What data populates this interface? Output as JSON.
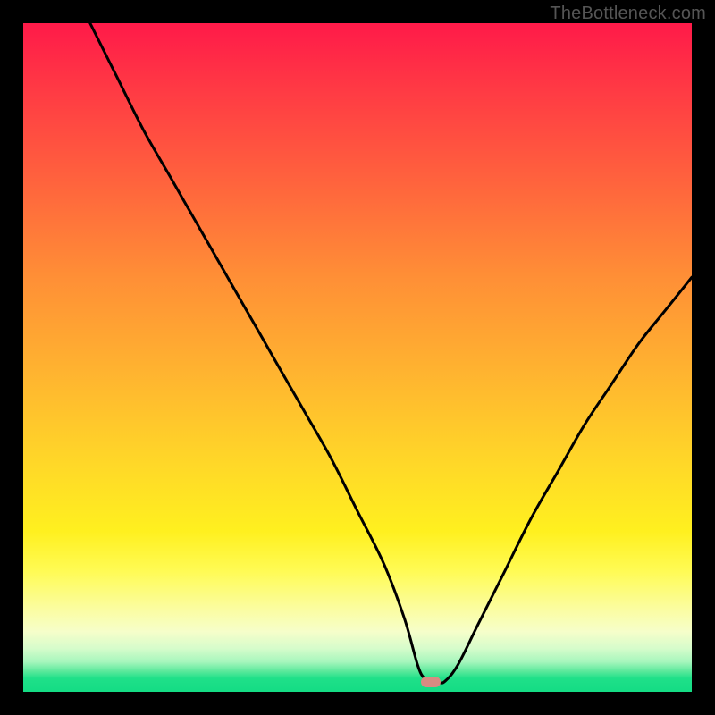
{
  "watermark": "TheBottleneck.com",
  "colors": {
    "frame_bg": "#000000",
    "curve": "#000000",
    "marker": "#d98b82",
    "gradient_top": "#ff1a49",
    "gradient_mid": "#fff01f",
    "gradient_bottom": "#14dc84"
  },
  "chart_data": {
    "type": "line",
    "title": "",
    "xlabel": "",
    "ylabel": "",
    "xlim": [
      0,
      100
    ],
    "ylim": [
      0,
      100
    ],
    "grid": false,
    "legend": false,
    "notes": "V-shaped bottleneck curve over a red→yellow→green vertical gradient. y ≈ 100 is top (high bottleneck, red zone); y ≈ 0 is bottom (no bottleneck, green zone). Minimum sits near x ≈ 59–63 on the green floor. A small salmon pill marker denotes the optimal point.",
    "marker": {
      "x": 61,
      "y": 1.5
    },
    "series": [
      {
        "name": "bottleneck-curve",
        "x": [
          10,
          14,
          18,
          22,
          26,
          30,
          34,
          38,
          42,
          46,
          50,
          54,
          57,
          59,
          60,
          61,
          62,
          63,
          65,
          68,
          72,
          76,
          80,
          84,
          88,
          92,
          96,
          100
        ],
        "y": [
          100,
          92,
          84,
          77,
          70,
          63,
          56,
          49,
          42,
          35,
          27,
          19,
          11,
          4,
          2,
          1.5,
          1.5,
          1.5,
          4,
          10,
          18,
          26,
          33,
          40,
          46,
          52,
          57,
          62
        ]
      }
    ]
  }
}
